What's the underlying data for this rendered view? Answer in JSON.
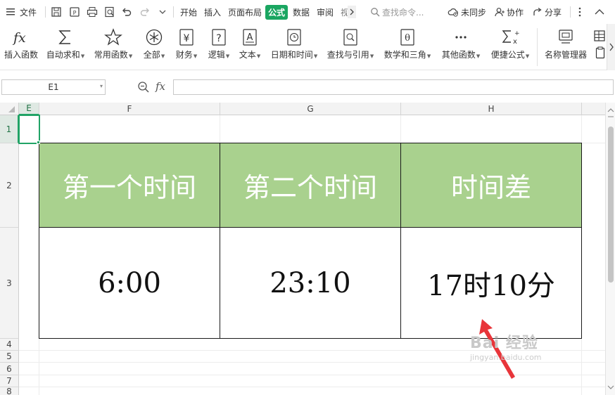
{
  "menubar": {
    "menu_label": "文件",
    "tabs": [
      "开始",
      "插入",
      "页面布局",
      "公式",
      "数据",
      "审阅",
      "视"
    ],
    "active_tab": "公式",
    "search_placeholder": "查找命令...",
    "sync_label": "未同步",
    "collab_label": "协作",
    "share_label": "分享"
  },
  "ribbon": {
    "items": [
      {
        "label": "插入函数",
        "icon": "function-fx-icon",
        "dropdown": false
      },
      {
        "label": "自动求和",
        "icon": "sigma-sum-icon",
        "dropdown": true
      },
      {
        "label": "常用函数",
        "icon": "star-icon",
        "dropdown": true
      },
      {
        "label": "全部",
        "icon": "asterisk-circle-icon",
        "dropdown": true
      },
      {
        "label": "财务",
        "icon": "yen-icon",
        "dropdown": true
      },
      {
        "label": "逻辑",
        "icon": "question-box-icon",
        "dropdown": true
      },
      {
        "label": "文本",
        "icon": "text-a-icon",
        "dropdown": true
      },
      {
        "label": "日期和时间",
        "icon": "clock-icon",
        "dropdown": true
      },
      {
        "label": "查找与引用",
        "icon": "search-box-icon",
        "dropdown": true
      },
      {
        "label": "数学和三角",
        "icon": "theta-icon",
        "dropdown": true
      },
      {
        "label": "其他函数",
        "icon": "ellipsis-icon",
        "dropdown": true
      },
      {
        "label": "便捷公式",
        "icon": "sigma-x-icon",
        "dropdown": true
      },
      {
        "label": "名称管理器",
        "icon": "name-manager-icon",
        "dropdown": false
      }
    ]
  },
  "formula_bar": {
    "name_box": "E1",
    "fx_label": "fx",
    "content": ""
  },
  "sheet": {
    "columns": [
      "E",
      "F",
      "G",
      "H"
    ],
    "rows": [
      "1",
      "2",
      "3",
      "4",
      "5",
      "6",
      "7",
      "8"
    ],
    "selected_column": "E",
    "selected_row": "1",
    "header_cells": [
      "第一个时间",
      "第二个时间",
      "时间差"
    ],
    "value_cells": [
      "6:00",
      "23:10",
      "17时10分"
    ]
  },
  "watermark": {
    "main": "Bai 经验",
    "url": "jingyan.baidu.com"
  },
  "colors": {
    "accent": "#1aa661",
    "header_fill": "#a9d18e",
    "selection": "#21a366",
    "arrow": "#e8353a"
  }
}
